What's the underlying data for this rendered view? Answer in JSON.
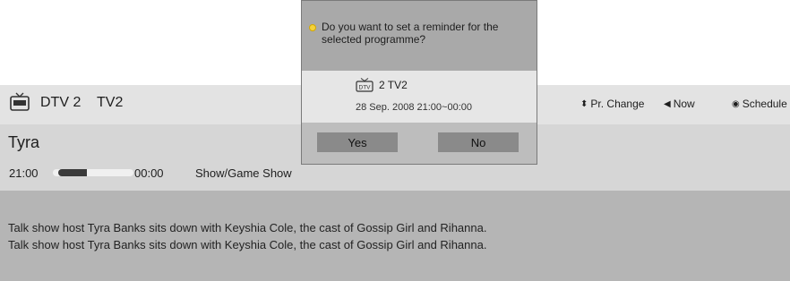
{
  "channel": {
    "number_label": "DTV 2",
    "name": "TV2"
  },
  "nav": {
    "pr_change_label": "Pr. Change",
    "now_label": "Now",
    "schedule_label": "Schedule"
  },
  "program": {
    "title": "Tyra",
    "start_time": "21:00",
    "end_time": "00:00",
    "progress_fraction": 0.35,
    "genre": "Show/Game Show",
    "description_lines": [
      "Talk show host Tyra Banks sits down with Keyshia Cole, the cast of Gossip Girl and Rihanna.",
      "Talk show host Tyra Banks sits down with Keyshia Cole, the cast of Gossip Girl and Rihanna."
    ]
  },
  "dialog": {
    "message": "Do you want to set a reminder for the selected programme?",
    "icon_label": "DTV",
    "channel": "2 TV2",
    "date_time": "28 Sep. 2008 21:00~00:00",
    "yes_label": "Yes",
    "no_label": "No"
  },
  "colors": {
    "channel_bar": "#e3e3e3",
    "program_bar": "#d6d6d6",
    "description_bar": "#b5b5b5",
    "dialog_button": "#8a8a8a"
  }
}
